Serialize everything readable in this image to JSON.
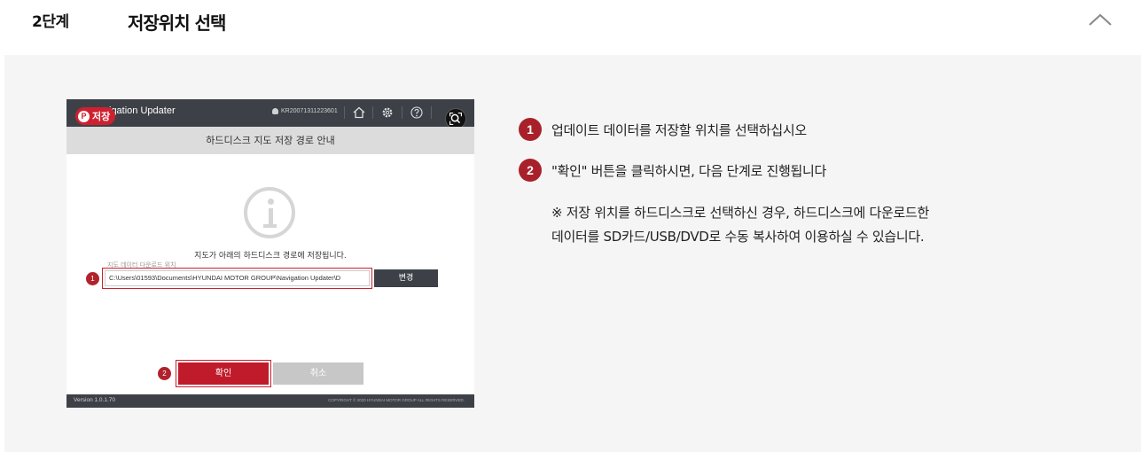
{
  "header": {
    "step_label": "2단계",
    "step_title": "저장위치 선택",
    "collapse_icon": "chevron-up-icon"
  },
  "screenshot": {
    "pin_badge": "저장",
    "app_title": "igation Updater",
    "user_id": "KR20071311223601",
    "icons": [
      "home-icon",
      "gear-icon",
      "help-icon",
      "lens-icon"
    ],
    "subtitle": "하드디스크 지도 저장 경로 안내",
    "message": "지도가 아래의 하드디스크 경로에 저장됩니다.",
    "field_label": "지도 데이터 다운로드 위치",
    "marker_1": "1",
    "path_value": "C:\\Users\\01593\\Documents\\HYUNDAI MOTOR GROUP\\Navigation Updater\\D",
    "change_button": "변경",
    "marker_2": "2",
    "confirm_button": "확인",
    "cancel_button": "취소",
    "version": "Version 1.0.1.70",
    "copyright": "COPYRIGHT © 2020 HYUNDAI MOTOR GROUP ALL RIGHTS RESERVED."
  },
  "instructions": [
    {
      "num": "1",
      "text": "업데이트 데이터를 저장할 위치를 선택하십시오"
    },
    {
      "num": "2",
      "text": "\"확인\" 버튼을 클릭하시면, 다음 단계로 진행됩니다"
    }
  ],
  "note": {
    "line1": "※ 저장 위치를 하드디스크로 선택하신 경우, 하드디스크에 다운로드한",
    "line2": "데이터를 SD카드/USB/DVD로 수동 복사하여 이용하실 수 있습니다."
  },
  "colors": {
    "accent_red": "#c01b2a",
    "number_red": "#a8212a",
    "dark_bar": "#3d4147",
    "panel_bg": "#f5f5f5"
  }
}
